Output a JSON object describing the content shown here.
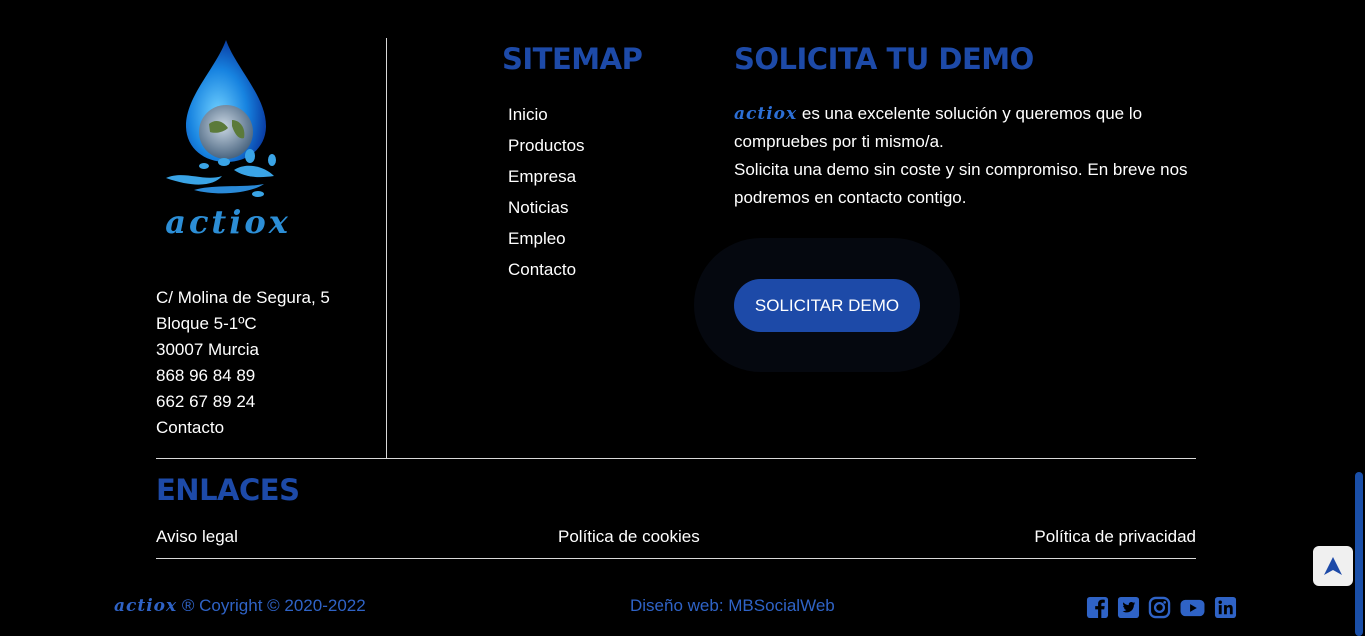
{
  "logo": {
    "brand": "actiox"
  },
  "address": {
    "lines": [
      "C/ Molina de Segura, 5",
      "Bloque 5-1ºC",
      "30007 Murcia",
      "868 96 84 89",
      "662 67 89 24"
    ],
    "contact_link": "Contacto"
  },
  "sitemap": {
    "title": "SITEMAP",
    "items": [
      "Inicio",
      "Productos",
      "Empresa",
      "Noticias",
      "Empleo",
      "Contacto"
    ]
  },
  "demo": {
    "title": "SOLICITA TU DEMO",
    "brand": "actiox",
    "text_1": " es una excelente solución y queremos que lo compruebes por ti mismo/a.",
    "text_2": "Solicita una demo sin coste y sin compromiso. En breve nos podremos en contacto contigo.",
    "button": "SOLICITAR DEMO"
  },
  "enlaces": {
    "title": "ENLACES",
    "links": [
      "Aviso legal",
      "Política de cookies",
      "Política de privacidad"
    ]
  },
  "footer": {
    "brand": "actiox",
    "copyright": " ® Coyright © 2020-2022",
    "design": "Diseño web: MBSocialWeb",
    "social": [
      "facebook-icon",
      "twitter-icon",
      "instagram-icon",
      "youtube-icon",
      "linkedin-icon"
    ]
  },
  "colors": {
    "accent": "#1d4aa8",
    "footer_text": "#2f63c6",
    "background": "#000000"
  }
}
